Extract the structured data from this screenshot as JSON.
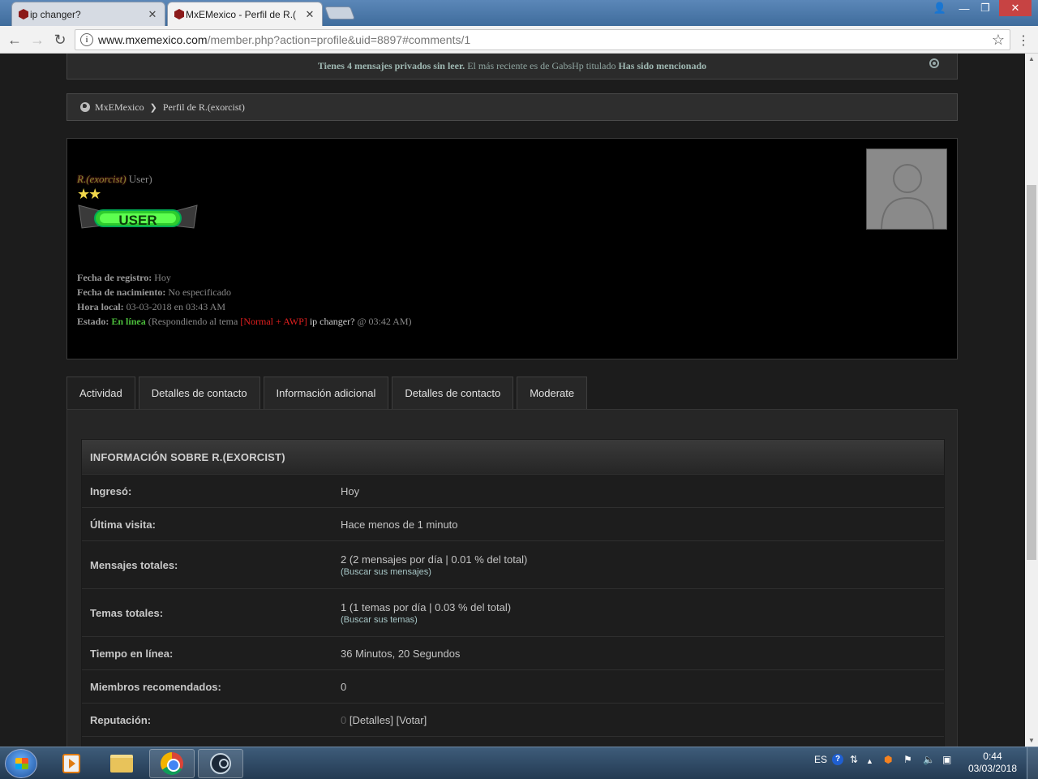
{
  "browser": {
    "tabs": [
      {
        "title": "ip changer?",
        "close": "✕"
      },
      {
        "title": "MxEMexico - Perfil de R.(",
        "close": "✕"
      }
    ],
    "url_host": "www.mxemexico.com",
    "url_path": "/member.php?action=profile&uid=8897#comments/1"
  },
  "notice": {
    "strong_msg": "Tienes 4 mensajes privados sin leer.",
    "middle": " El más reciente es de GabsHp titulado ",
    "subject": "Has sido mencionado"
  },
  "breadcrumb": {
    "home": "MxEMexico",
    "current": "Perfil de R.(exorcist)"
  },
  "profile": {
    "username": "R.(exorcist)",
    "usergroup": " User)",
    "stars": "★★",
    "rank_badge_text": "USER",
    "fields": {
      "reg_label": "Fecha de registro:",
      "reg_value": " Hoy",
      "birth_label": "Fecha de nacimiento:",
      "birth_value": " No especificado",
      "time_label": "Hora local:",
      "time_value": " 03-03-2018 en 03:43 AM",
      "status_label": "Estado:",
      "status_value": " En línea",
      "status_pre": " (Respondiendo al tema ",
      "status_tag": "[Normal + AWP]",
      "status_thread": " ip changer?",
      "status_post": " @ 03:42 AM)"
    }
  },
  "tabs": [
    "Actividad",
    "Detalles de contacto",
    "Información adicional",
    "Detalles de contacto",
    "Moderate"
  ],
  "info": {
    "header": "INFORMACIÓN SOBRE R.(EXORCIST)",
    "rows": {
      "joined_label": "Ingresó:",
      "joined_value": "Hoy",
      "last_label": "Última visita:",
      "last_value": "Hace menos de 1 minuto",
      "posts_label": "Mensajes totales:",
      "posts_value": "2 (2 mensajes por día | 0.01 % del total)",
      "posts_link": "(Buscar sus mensajes)",
      "threads_label": "Temas totales:",
      "threads_value": "1 (1 temas por día | 0.03 % del total)",
      "threads_link": "(Buscar sus temas)",
      "online_label": "Tiempo en línea:",
      "online_value": "36 Minutos, 20 Segundos",
      "referrals_label": "Miembros recomendados:",
      "referrals_value": "0",
      "rep_label": "Reputación:",
      "rep_value": "0",
      "rep_links": " [Detalles] [Votar]"
    }
  },
  "taskbar": {
    "lang": "ES",
    "time": "0:44",
    "date": "03/03/2018"
  }
}
